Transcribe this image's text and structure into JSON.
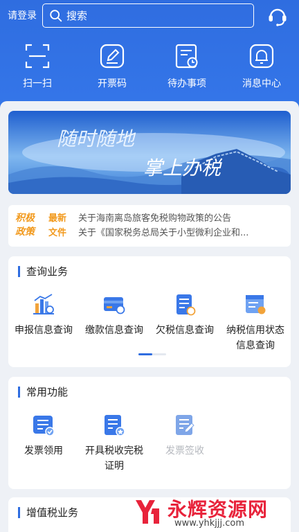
{
  "header": {
    "login_label": "请登录",
    "search_placeholder": "搜索",
    "quick_actions": [
      {
        "label": "扫一扫",
        "icon": "scan-icon"
      },
      {
        "label": "开票码",
        "icon": "invoice-code-icon"
      },
      {
        "label": "待办事项",
        "icon": "todo-icon"
      },
      {
        "label": "消息中心",
        "icon": "bell-icon"
      }
    ]
  },
  "banner": {
    "line1": "随时随地",
    "line2": "掌上办税"
  },
  "news": {
    "tag_policy_1": "积极",
    "tag_policy_2": "政策",
    "tag_latest_1": "最新",
    "tag_latest_2": "文件",
    "items": [
      "关于海南离岛旅客免税购物政策的公告",
      "关于《国家税务总局关于小型微利企业和..."
    ]
  },
  "query": {
    "title": "查询业务",
    "items": [
      {
        "label": "申报信息查询",
        "icon": "declare-chart-icon"
      },
      {
        "label": "缴款信息查询",
        "icon": "payment-card-icon"
      },
      {
        "label": "欠税信息查询",
        "icon": "arrears-doc-icon"
      },
      {
        "label": "纳税信用状态信息查询",
        "icon": "credit-doc-icon"
      }
    ],
    "page_index": 1,
    "page_count": 2
  },
  "common": {
    "title": "常用功能",
    "items": [
      {
        "label": "发票领用",
        "icon": "invoice-receive-icon",
        "enabled": true
      },
      {
        "label": "开具税收完税证明",
        "icon": "tax-certificate-icon",
        "enabled": true
      },
      {
        "label": "发票签收",
        "icon": "invoice-sign-icon",
        "enabled": false
      }
    ]
  },
  "vat": {
    "title": "增值税业务"
  },
  "watermark": {
    "name": "永辉资源网",
    "url": "www.yhkjjj.com"
  },
  "colors": {
    "primary": "#2f6de0",
    "accent_orange": "#f29a1e",
    "watermark_red": "#e8233b"
  }
}
